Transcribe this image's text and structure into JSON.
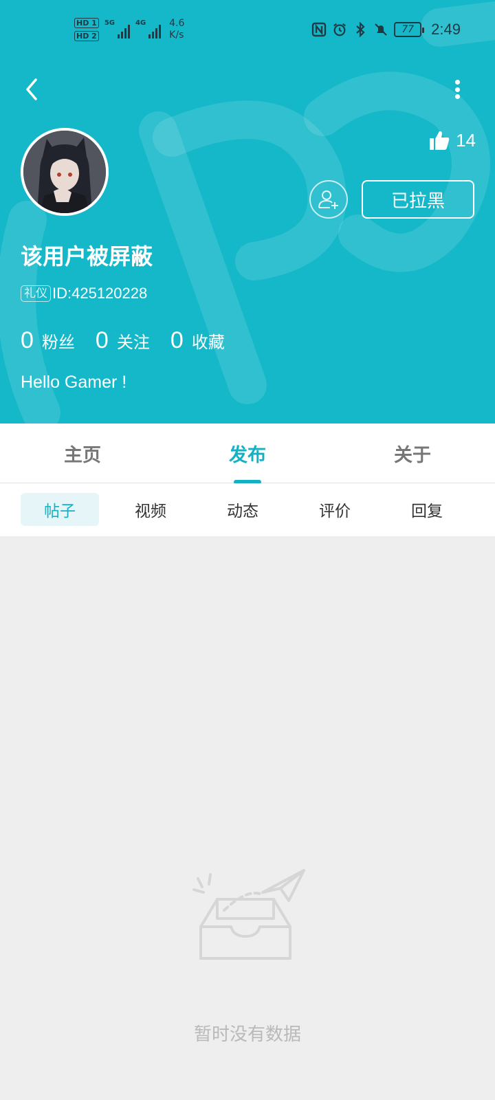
{
  "status_bar": {
    "hd1": "HD 1",
    "hd2": "HD 2",
    "sig1_label": "5G",
    "sig2_label": "4G",
    "speed_value": "4.6",
    "speed_unit": "K/s",
    "battery": "77",
    "time": "2:49"
  },
  "header": {
    "likes": "14",
    "blocked_label": "已拉黑",
    "username": "该用户被屏蔽",
    "tag": "礼仪",
    "user_id": "ID:425120228",
    "bio": "Hello Gamer !",
    "stats": [
      {
        "num": "0",
        "label": "粉丝"
      },
      {
        "num": "0",
        "label": "关注"
      },
      {
        "num": "0",
        "label": "收藏"
      }
    ],
    "bg_color": "#15b8c9"
  },
  "tabs": {
    "main": [
      "主页",
      "发布",
      "关于"
    ],
    "active_main": "发布",
    "sub": [
      "帖子",
      "视频",
      "动态",
      "评价",
      "回复"
    ],
    "active_sub": "帖子"
  },
  "empty_state": {
    "text": "暂时没有数据",
    "icon": "empty-inbox-icon"
  },
  "colors": {
    "accent": "#15b1c3",
    "header": "#15b8c9",
    "page_bg": "#eeeeee"
  }
}
